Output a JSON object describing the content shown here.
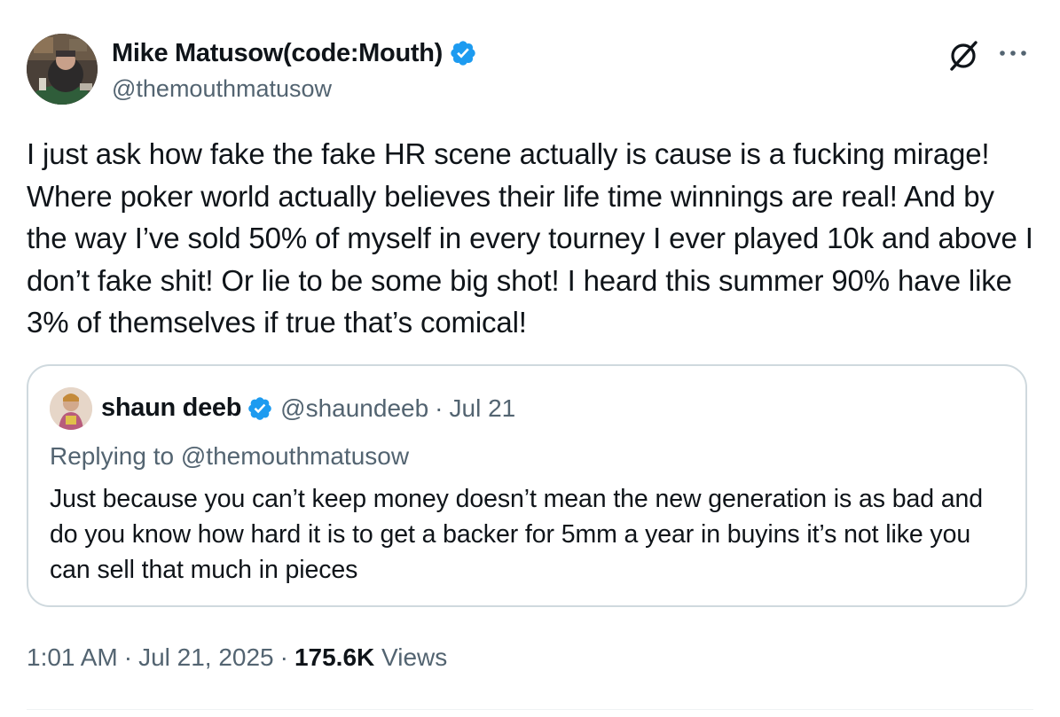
{
  "author": {
    "display_name": "Mike Matusow(code:Mouth)",
    "handle": "@themouthmatusow",
    "verified_icon": "verified-badge-icon",
    "verified_color": "#1d9bf0"
  },
  "header_actions": {
    "grok_icon": "grok-icon",
    "more_icon": "more-horizontal-icon"
  },
  "tweet": {
    "text": "I just ask how fake the fake HR scene actually is cause is a fucking mirage! Where poker world actually believes their life time winnings are real! And by the way I’ve sold 50% of myself in every tourney I ever played 10k and above I don’t fake shit! Or lie to be some big shot! I heard this summer 90% have like 3% of themselves if true that’s comical!"
  },
  "quote": {
    "display_name": "shaun deeb",
    "handle": "@shaundeeb",
    "separator": "·",
    "date": "Jul 21",
    "replying_to": "Replying to @themouthmatusow",
    "text": "Just because you can’t keep money doesn’t mean the new generation is as bad and do you know how hard it is to get a backer for 5mm a year in buyins it’s not like you can sell that much in pieces"
  },
  "meta": {
    "time": "1:01 AM",
    "separator": "·",
    "date": "Jul 21, 2025",
    "views_count": "175.6K",
    "views_label": "Views"
  },
  "colors": {
    "text": "#0f1419",
    "secondary": "#536471",
    "border": "#cfd9de",
    "accent": "#1d9bf0"
  }
}
